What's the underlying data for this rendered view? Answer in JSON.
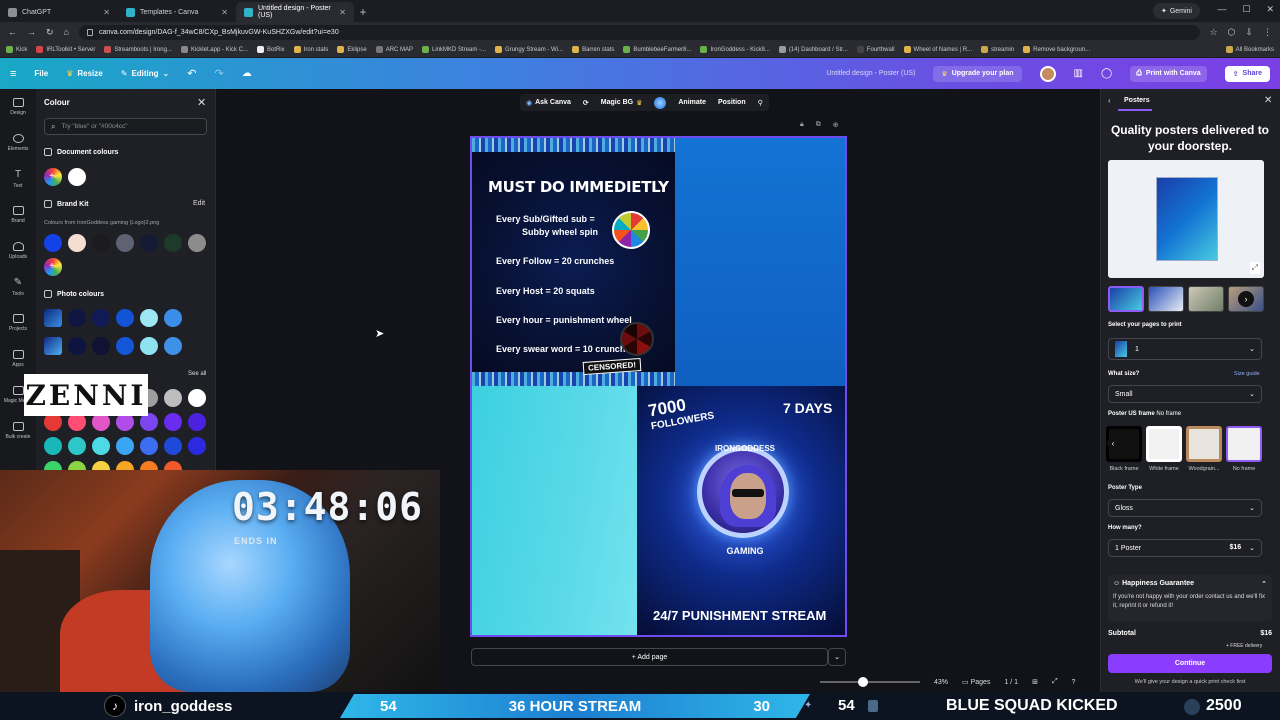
{
  "browser": {
    "tabs": [
      {
        "label": "ChatGPT",
        "active": false
      },
      {
        "label": "Templates - Canva",
        "active": false
      },
      {
        "label": "Untitled design - Poster (US)",
        "active": true
      }
    ],
    "gemini_label": "Gemini",
    "url": "canva.com/design/DAG-f_34wC8/CXp_BsMjkuvGW-KuSHZXGw/edit?ui=e30",
    "bookmarks": [
      "Kick",
      "IRLToolkit • Server",
      "Streamboots | Irong...",
      "Kicklet.app - Kick C...",
      "BotRix",
      "Iron stats",
      "Eklipse",
      "ARC MAP",
      "LinkMKD Stream -...",
      "Grungy Stream - Wi...",
      "Barren stats",
      "BumblebeeFarmer8...",
      "IronGoddess - Kick8...",
      "(14) Dashboard / Str...",
      "Fourthwall",
      "Wheel of Names | R...",
      "streamin",
      "Remove backgroun..."
    ],
    "all_bookmarks": "All Bookmarks"
  },
  "canva_header": {
    "file": "File",
    "resize": "Resize",
    "editing": "Editing",
    "doc_title": "Untitled design - Poster (US)",
    "upgrade": "Upgrade your plan",
    "print": "Print with Canva",
    "share": "Share"
  },
  "rail": [
    {
      "label": "Design",
      "icon": "layout-icon"
    },
    {
      "label": "Elements",
      "icon": "shapes-icon"
    },
    {
      "label": "Text",
      "icon": "text-icon"
    },
    {
      "label": "Brand",
      "icon": "brand-icon"
    },
    {
      "label": "Uploads",
      "icon": "upload-icon"
    },
    {
      "label": "Tools",
      "icon": "tools-icon"
    },
    {
      "label": "Projects",
      "icon": "folder-icon"
    },
    {
      "label": "Apps",
      "icon": "apps-icon"
    },
    {
      "label": "Magic Media",
      "icon": "magic-icon"
    },
    {
      "label": "Bulk create",
      "icon": "bulk-icon"
    }
  ],
  "colour_panel": {
    "title": "Colour",
    "search_placeholder": "Try \"blue\" or \"#00c4cc\"",
    "document_colours": "Document colours",
    "brand_kit": "Brand Kit",
    "edit": "Edit",
    "brand_sub": "Colours from IronGoddess gaming (Logo)2.png",
    "photo_colours": "Photo colours",
    "see_all": "See all",
    "doc_swatches": [
      "#ffffff"
    ],
    "brand_swatches": [
      "#1343e8",
      "#f6ddd2",
      "#1c1c1e",
      "#5f6272",
      "#141a33",
      "#1e3a28",
      "#8c8c8c"
    ],
    "photo_row1": [
      "#0f1640",
      "#101a56",
      "#1353d6",
      "#9ce7f2",
      "#3a8ee8"
    ],
    "photo_row2": [
      "#0e1440",
      "#101234",
      "#1555d8",
      "#8fe3f0",
      "#3f90e9"
    ],
    "default_row1": [
      "#9e9e9e",
      "#bdbdbd",
      "#ffffff"
    ],
    "default_row2": [
      "#e53935",
      "#ff4d73",
      "#e056c9",
      "#b04de8",
      "#7b46f0",
      "#6a2cf0",
      "#4a22e0"
    ],
    "default_row3": [
      "#18b8b8",
      "#2ec7c7",
      "#4dd9e6",
      "#3aa5f5",
      "#3b6ef0",
      "#1f4ad8",
      "#2c2ae0"
    ],
    "default_row4": [
      "#3bd46a",
      "#8bd443",
      "#f5d040",
      "#f5a623",
      "#f57c23",
      "#f0592b"
    ]
  },
  "toolbar": {
    "ask_canva": "Ask Canva",
    "magic_bg": "Magic BG",
    "animate": "Animate",
    "position": "Position"
  },
  "poster": {
    "title": "MUST DO IMMEDIETLY",
    "rules": [
      "Every Sub/Gifted sub =",
      "Subby wheel spin",
      "Every Follow = 20 crunches",
      "Every Host = 20 squats",
      "Every hour = punishment wheel",
      "Every swear word = 10 crunches"
    ],
    "censored": "CENSORED!",
    "followers_num": "7000",
    "followers_label": "FOLLOWERS",
    "days": "7 DAYS",
    "ring_top": "IRONGODDESS",
    "ring_bottom": "GAMING",
    "punishment": "24/7 PUNISHMENT STREAM"
  },
  "canvas_footer": {
    "add_page": "+ Add page",
    "zoom": "43%",
    "zoom_fraction": 0.43,
    "pages_label": "Pages",
    "pages_count": "1 / 1"
  },
  "print_panel": {
    "tab": "Posters",
    "headline": "Quality posters delivered to your doorstep.",
    "select_pages": "Select your pages to print",
    "page_value": "1",
    "what_size": "What size?",
    "size_guide": "Size guide",
    "size_value": "Small",
    "frame_label": "Poster US frame",
    "frame_value": "No frame",
    "frames": [
      "Black frame",
      "White frame",
      "Woodgrain...",
      "No frame"
    ],
    "poster_type": "Poster Type",
    "type_value": "Gloss",
    "how_many": "How many?",
    "qty_value": "1 Poster",
    "qty_price": "$16",
    "guarantee_title": "Happiness Guarantee",
    "guarantee_text": "If you're not happy with your order contact us and we'll fix it, reprint it or refund it!",
    "subtotal_label": "Subtotal",
    "subtotal_value": "$16",
    "free_delivery": "+ FREE delivery",
    "continue": "Continue",
    "check_note": "We'll give your design a quick print check first"
  },
  "stream": {
    "timer": "03:48:06",
    "ends_in": "ENDS IN",
    "zenni": "ZENNI",
    "handle": "iron_goddess",
    "left_num": "54",
    "banner_text": "36 HOUR STREAM",
    "right_num": "30",
    "stat": "54",
    "squad": "BLUE SQUAD KICKED",
    "count": "2500"
  }
}
